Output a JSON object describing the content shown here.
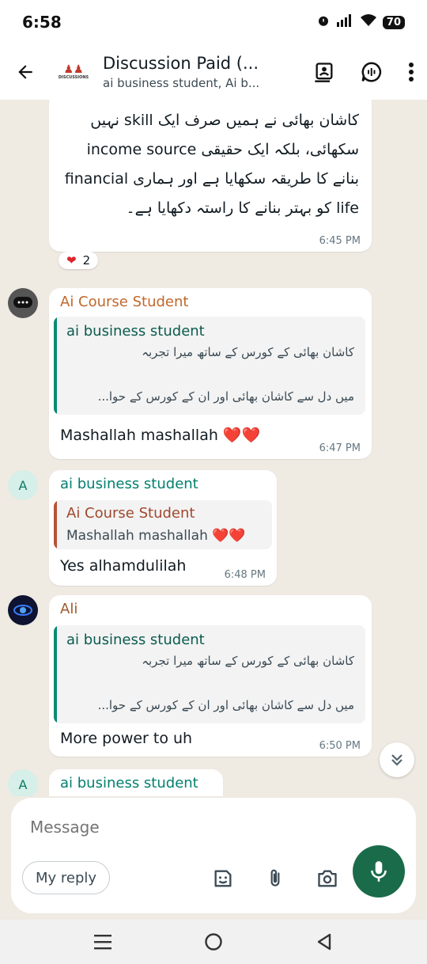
{
  "status": {
    "time": "6:58",
    "battery": "70"
  },
  "header": {
    "title": "Discussion Paid (...",
    "subtitle": "ai business student, Ai b...",
    "logo_text": "DISCUSSIONS"
  },
  "messages": {
    "m1": {
      "lines": [
        "کاشان بھائی نے ہمیں صرف ایک skill نہیں",
        "سکھائی، بلکہ ایک حقیقی income source",
        "بنانے کا طریقہ سکھایا ہے اور ہماری financial",
        "life کو بہتر بنانے کا راستہ دکھایا ہے۔"
      ],
      "time": "6:45 PM",
      "reaction_count": "2"
    },
    "m2": {
      "sender": "Ai Course Student",
      "quote_name": "ai business student",
      "quote_line1": "کاشان بھائی کے کورس کے ساتھ میرا تجربہ",
      "quote_line2": "میں دل سے کاشان بھائی اور ان کے کورس کے حوا...",
      "text": "Mashallah mashallah ❤️❤️",
      "time": "6:47 PM"
    },
    "m3": {
      "avatar_letter": "A",
      "sender": "ai business student",
      "quote_name": "Ai Course Student",
      "quote_text": "Mashallah mashallah ❤️❤️",
      "text": "Yes alhamdulilah",
      "time": "6:48 PM"
    },
    "m4": {
      "sender": "Ali",
      "quote_name": "ai business student",
      "quote_line1": "کاشان بھائی کے کورس کے ساتھ میرا تجربہ",
      "quote_line2": "میں دل سے کاشان بھائی اور ان کے کورس کے حوا...",
      "text": "More power to uh",
      "time": "6:50 PM"
    },
    "m5": {
      "avatar_letter": "A",
      "sender": "ai business student"
    }
  },
  "composer": {
    "placeholder": "Message",
    "chip": "My reply"
  },
  "colors": {
    "accent_green": "#1a6b4a",
    "sender_orange": "#c0672b",
    "sender_teal": "#027f6f",
    "sender_brown": "#a05a2c",
    "quote_bar_teal": "#0b8a72",
    "quote_bar_red": "#b5543a"
  }
}
